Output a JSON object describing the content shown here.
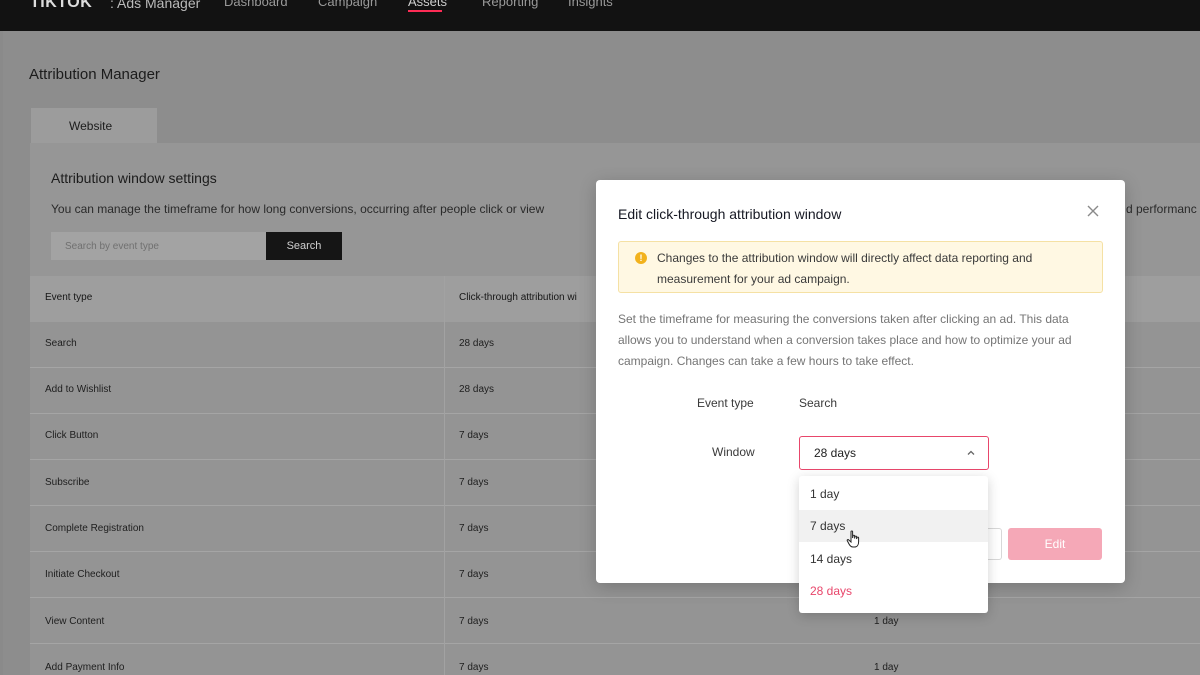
{
  "nav": {
    "brand": "TIKTOK",
    "brand_sub": ": Ads Manager",
    "items": [
      "Dashboard",
      "Campaign",
      "Assets",
      "Reporting",
      "Insights"
    ]
  },
  "page": {
    "title": "Attribution Manager",
    "tab": "Website",
    "section_title": "Attribution window settings",
    "section_desc": "You can manage the timeframe for how long conversions, occurring after people click or view",
    "section_desc_tail": "d performanc",
    "search_placeholder": "Search by event type",
    "search_button": "Search"
  },
  "table": {
    "headers": [
      "Event type",
      "Click-through attribution wi"
    ],
    "rows": [
      {
        "event": "Search",
        "click": "28 days",
        "view": ""
      },
      {
        "event": "Add to Wishlist",
        "click": "28 days",
        "view": ""
      },
      {
        "event": "Click Button",
        "click": "7 days",
        "view": ""
      },
      {
        "event": "Subscribe",
        "click": "7 days",
        "view": ""
      },
      {
        "event": "Complete Registration",
        "click": "7 days",
        "view": ""
      },
      {
        "event": "Initiate Checkout",
        "click": "7 days",
        "view": ""
      },
      {
        "event": "View Content",
        "click": "7 days",
        "view": "1 day"
      },
      {
        "event": "Add Payment Info",
        "click": "7 days",
        "view": "1 day"
      }
    ]
  },
  "modal": {
    "title": "Edit click-through attribution window",
    "alert": "Changes to the attribution window will directly affect data reporting and measurement for your ad campaign.",
    "description": "Set the timeframe for measuring the conversions taken after clicking an ad. This data allows you to understand when a conversion takes place and how to optimize your ad campaign. Changes can take a few hours to take effect.",
    "event_type_label": "Event type",
    "event_type_value": "Search",
    "window_label": "Window",
    "window_value": "28 days",
    "edit_button": "Edit",
    "options": [
      "1 day",
      "7 days",
      "14 days",
      "28 days"
    ]
  },
  "colors": {
    "accent": "#fe2c55",
    "selected_option": "#e8466b",
    "edit_disabled": "#f5a8b7",
    "alert_bg": "#fff8e3",
    "alert_icon": "#f2b21d"
  }
}
